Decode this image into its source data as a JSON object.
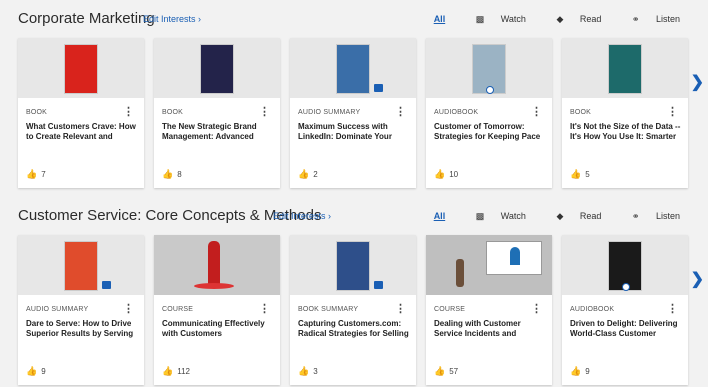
{
  "sections": [
    {
      "title": "Corporate Marketing",
      "edit_label": "Edit Interests",
      "filters": [
        "All",
        "Watch",
        "Read",
        "Listen"
      ],
      "cards": [
        {
          "type": "BOOK",
          "title": "What Customers Crave: How to Create Relevant and",
          "likes": "7",
          "cover": "#d9231c"
        },
        {
          "type": "BOOK",
          "title": "The New Strategic Brand Management: Advanced",
          "likes": "8",
          "cover": "#23234a"
        },
        {
          "type": "AUDIO SUMMARY",
          "title": "Maximum Success with LinkedIn: Dominate Your",
          "likes": "2",
          "cover": "#3a6ea8"
        },
        {
          "type": "AUDIOBOOK",
          "title": "Customer of Tomorrow: Strategies for Keeping Pace",
          "likes": "10",
          "cover": "#9bb3c4"
        },
        {
          "type": "BOOK",
          "title": "It's Not the Size of the Data -- It's How You Use It: Smarter",
          "likes": "5",
          "cover": "#1d6a6a"
        }
      ]
    },
    {
      "title": "Customer Service: Core Concepts & Methods",
      "edit_label": "Edit Interests",
      "filters": [
        "All",
        "Watch",
        "Read",
        "Listen"
      ],
      "cards": [
        {
          "type": "AUDIO SUMMARY",
          "title": "Dare to Serve: How to Drive Superior Results by Serving",
          "likes": "9",
          "cover": "#e04c2c"
        },
        {
          "type": "COURSE",
          "title": "Communicating Effectively with Customers",
          "likes": "112",
          "cover": "#c9c9c9"
        },
        {
          "type": "BOOK SUMMARY",
          "title": "Capturing Customers.com: Radical Strategies for Selling",
          "likes": "3",
          "cover": "#2e4f8a"
        },
        {
          "type": "COURSE",
          "title": "Dealing with Customer Service Incidents and",
          "likes": "57",
          "cover": "#bfbfbf"
        },
        {
          "type": "AUDIOBOOK",
          "title": "Driven to Delight: Delivering World-Class Customer",
          "likes": "9",
          "cover": "#1a1a1a"
        }
      ]
    }
  ]
}
